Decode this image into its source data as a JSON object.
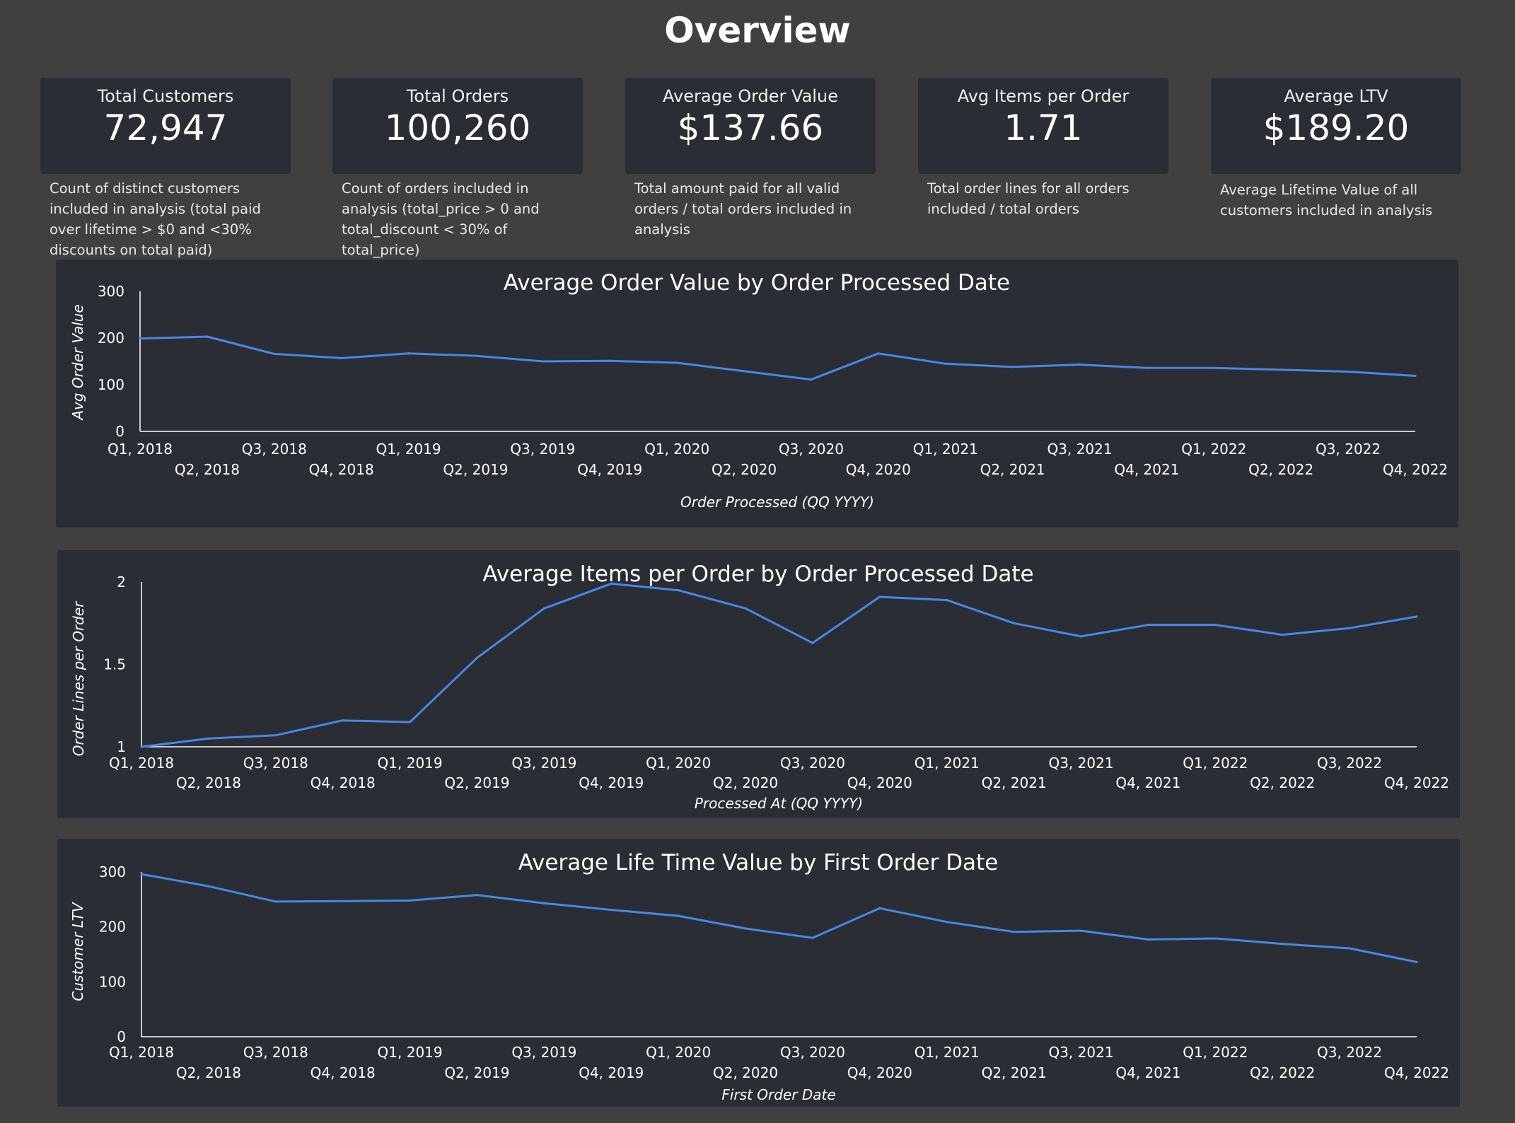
{
  "page": {
    "title": "Overview"
  },
  "kpis": [
    {
      "label": "Total Customers",
      "value": "72,947",
      "description": "Count of distinct customers included in analysis (total paid over lifetime > $0 and <30% discounts on total paid)"
    },
    {
      "label": "Total Orders",
      "value": "100,260",
      "description": "Count of orders included in analysis (total_price > 0 and total_discount < 30% of total_price)"
    },
    {
      "label": "Average Order Value",
      "value": "$137.66",
      "description": "Total amount paid for all valid orders / total orders included in analysis"
    },
    {
      "label": "Avg Items per Order",
      "value": "1.71",
      "description": "Total order lines for all orders included / total orders"
    },
    {
      "label": "Average LTV",
      "value": "$189.20",
      "description": "Average Lifetime Value of all customers included in analysis"
    }
  ],
  "colors": {
    "line": "#4a86e8",
    "panel": "#2b2d34",
    "background": "#404040"
  },
  "chart_data": [
    {
      "type": "line",
      "title": "Average Order Value by Order Processed Date",
      "xlabel": "Order Processed (QQ YYYY)",
      "ylabel": "Avg Order Value",
      "ylim": [
        0,
        300
      ],
      "yticks": [
        "0",
        "100",
        "200",
        "300"
      ],
      "categories": [
        "Q1, 2018",
        "Q2, 2018",
        "Q3, 2018",
        "Q4, 2018",
        "Q1, 2019",
        "Q2, 2019",
        "Q3, 2019",
        "Q4, 2019",
        "Q1, 2020",
        "Q2, 2020",
        "Q3, 2020",
        "Q4, 2020",
        "Q1, 2021",
        "Q2, 2021",
        "Q3, 2021",
        "Q4, 2021",
        "Q1, 2022",
        "Q2, 2022",
        "Q3, 2022",
        "Q4, 2022"
      ],
      "values": [
        199,
        203,
        166,
        157,
        167,
        162,
        150,
        151,
        147,
        129,
        111,
        167,
        145,
        138,
        143,
        136,
        136,
        132,
        128,
        119
      ],
      "grid": false,
      "legend": "none"
    },
    {
      "type": "line",
      "title": "Average Items per Order by Order Processed Date",
      "xlabel": "Processed At (QQ YYYY)",
      "ylabel": "Order Lines per Order",
      "ylim": [
        1,
        2
      ],
      "yticks": [
        "1",
        "1.5",
        "2"
      ],
      "categories": [
        "Q1, 2018",
        "Q2, 2018",
        "Q3, 2018",
        "Q4, 2018",
        "Q1, 2019",
        "Q2, 2019",
        "Q3, 2019",
        "Q4, 2019",
        "Q1, 2020",
        "Q2, 2020",
        "Q3, 2020",
        "Q4, 2020",
        "Q1, 2021",
        "Q2, 2021",
        "Q3, 2021",
        "Q4, 2021",
        "Q1, 2022",
        "Q2, 2022",
        "Q3, 2022",
        "Q4, 2022"
      ],
      "values": [
        1.0,
        1.05,
        1.07,
        1.16,
        1.15,
        1.54,
        1.84,
        1.99,
        1.95,
        1.84,
        1.63,
        1.91,
        1.89,
        1.75,
        1.67,
        1.74,
        1.74,
        1.68,
        1.72,
        1.79
      ],
      "grid": false,
      "legend": "none"
    },
    {
      "type": "line",
      "title": "Average Life Time Value by First Order Date",
      "xlabel": "First Order Date",
      "ylabel": "Customer LTV",
      "ylim": [
        0,
        300
      ],
      "yticks": [
        "0",
        "100",
        "200",
        "300"
      ],
      "categories": [
        "Q1, 2018",
        "Q2, 2018",
        "Q3, 2018",
        "Q4, 2018",
        "Q1, 2019",
        "Q2, 2019",
        "Q3, 2019",
        "Q4, 2019",
        "Q1, 2020",
        "Q2, 2020",
        "Q3, 2020",
        "Q4, 2020",
        "Q1, 2021",
        "Q2, 2021",
        "Q3, 2021",
        "Q4, 2021",
        "Q1, 2022",
        "Q2, 2022",
        "Q3, 2022",
        "Q4, 2022"
      ],
      "values": [
        296,
        274,
        246,
        247,
        248,
        258,
        243,
        231,
        220,
        197,
        180,
        234,
        209,
        191,
        193,
        177,
        179,
        169,
        161,
        136
      ],
      "grid": false,
      "legend": "none"
    }
  ]
}
